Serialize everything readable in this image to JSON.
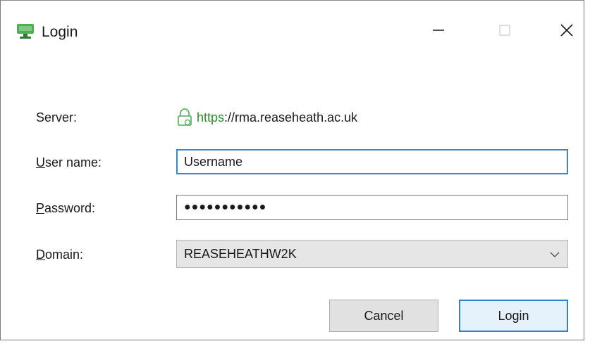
{
  "window": {
    "title": "Login",
    "accent": "#3a86c8"
  },
  "icons": {
    "app": "monitor-icon",
    "minimize": "minimize-icon",
    "maximize": "maximize-icon",
    "close": "close-icon",
    "lock": "lock-icon",
    "chevron": "chevron-down-icon"
  },
  "form": {
    "server": {
      "label": "Server:",
      "scheme": "https",
      "rest": "://rma.reaseheath.ac.uk"
    },
    "username": {
      "label_accel": "U",
      "label_rest": "ser name:",
      "value": "Username"
    },
    "password": {
      "label_accel": "P",
      "label_rest": "assword:",
      "value": "●●●●●●●●●●●"
    },
    "domain": {
      "label_accel": "D",
      "label_rest": "omain:",
      "value": "REASEHEATHW2K"
    }
  },
  "buttons": {
    "cancel": "Cancel",
    "login": "Login"
  }
}
